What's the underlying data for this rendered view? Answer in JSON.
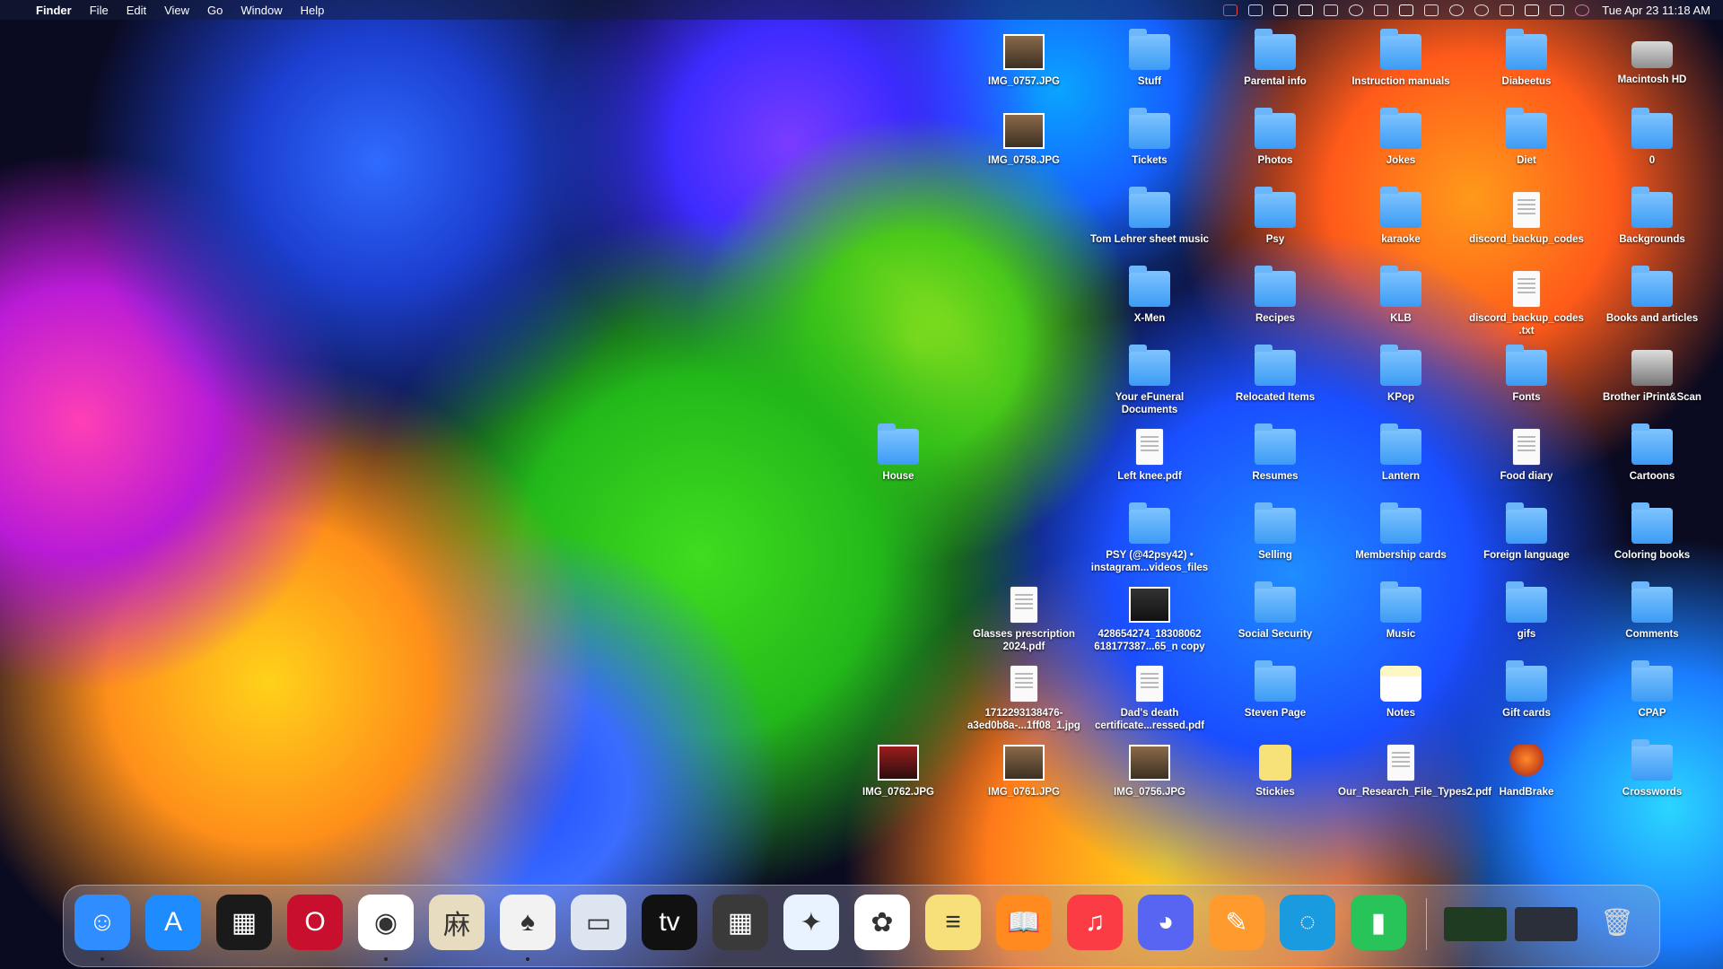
{
  "menubar": {
    "apple": "",
    "app_name": "Finder",
    "menus": [
      "File",
      "Edit",
      "View",
      "Go",
      "Window",
      "Help"
    ],
    "clock": "Tue Apr 23  11:18 AM",
    "status_icons": [
      "dropbox-icon",
      "audio-icon",
      "cloud-icon",
      "mail-icon",
      "display-icon",
      "play-icon",
      "bluetooth-icon",
      "wifi-icon",
      "keyboard-icon",
      "user-icon",
      "time-machine-icon",
      "eject-icon",
      "search-icon",
      "control-center-icon",
      "siri-icon"
    ]
  },
  "desktop": {
    "icons": [
      {
        "label": "IMG_0757.JPG",
        "type": "photo",
        "col": 0,
        "row": 0
      },
      {
        "label": "IMG_0758.JPG",
        "type": "photo",
        "col": 0,
        "row": 1
      },
      {
        "label": "Stuff",
        "type": "folder",
        "col": 1,
        "row": 0
      },
      {
        "label": "Tickets",
        "type": "folder",
        "col": 1,
        "row": 1
      },
      {
        "label": "Tom Lehrer sheet music",
        "type": "folder",
        "col": 1,
        "row": 2
      },
      {
        "label": "X-Men",
        "type": "folder",
        "col": 1,
        "row": 3
      },
      {
        "label": "Your eFuneral Documents",
        "type": "folder",
        "col": 1,
        "row": 4
      },
      {
        "label": "Parental info",
        "type": "folder",
        "col": 2,
        "row": 0
      },
      {
        "label": "Photos",
        "type": "folder",
        "col": 2,
        "row": 1
      },
      {
        "label": "Psy",
        "type": "folder",
        "col": 2,
        "row": 2
      },
      {
        "label": "Recipes",
        "type": "folder",
        "col": 2,
        "row": 3
      },
      {
        "label": "Relocated Items",
        "type": "folder",
        "col": 2,
        "row": 4
      },
      {
        "label": "Instruction manuals",
        "type": "folder",
        "col": 3,
        "row": 0
      },
      {
        "label": "Jokes",
        "type": "folder",
        "col": 3,
        "row": 1
      },
      {
        "label": "karaoke",
        "type": "folder",
        "col": 3,
        "row": 2
      },
      {
        "label": "KLB",
        "type": "folder",
        "col": 3,
        "row": 3
      },
      {
        "label": "KPop",
        "type": "folder",
        "col": 3,
        "row": 4
      },
      {
        "label": "Diabeetus",
        "type": "folder",
        "col": 4,
        "row": 0
      },
      {
        "label": "Diet",
        "type": "folder",
        "col": 4,
        "row": 1
      },
      {
        "label": "discord_backup_codes",
        "type": "doc",
        "col": 4,
        "row": 2
      },
      {
        "label": "discord_backup_codes .txt",
        "type": "doc",
        "col": 4,
        "row": 3
      },
      {
        "label": "Fonts",
        "type": "folder",
        "col": 4,
        "row": 4
      },
      {
        "label": "Macintosh HD",
        "type": "disk",
        "col": 5,
        "row": 0
      },
      {
        "label": "0",
        "type": "folder",
        "col": 5,
        "row": 1
      },
      {
        "label": "Backgrounds",
        "type": "folder",
        "col": 5,
        "row": 2
      },
      {
        "label": "Books and articles",
        "type": "folder",
        "col": 5,
        "row": 3
      },
      {
        "label": "Brother iPrint&Scan",
        "type": "printer",
        "col": 5,
        "row": 4
      },
      {
        "label": "House",
        "type": "folder",
        "col": -1,
        "row": 5
      },
      {
        "label": "Left knee.pdf",
        "type": "doc",
        "col": 1,
        "row": 5
      },
      {
        "label": "Resumes",
        "type": "folder",
        "col": 2,
        "row": 5
      },
      {
        "label": "Lantern",
        "type": "folder",
        "col": 3,
        "row": 5
      },
      {
        "label": "Food diary",
        "type": "doc",
        "col": 4,
        "row": 5
      },
      {
        "label": "Cartoons",
        "type": "folder",
        "col": 5,
        "row": 5
      },
      {
        "label": "PSY (@42psy42) • instagram...videos_files",
        "type": "folder",
        "col": 1,
        "row": 6
      },
      {
        "label": "Selling",
        "type": "folder",
        "col": 2,
        "row": 6
      },
      {
        "label": "Membership cards",
        "type": "folder",
        "col": 3,
        "row": 6
      },
      {
        "label": "Foreign language",
        "type": "folder",
        "col": 4,
        "row": 6
      },
      {
        "label": "Coloring books",
        "type": "folder",
        "col": 5,
        "row": 6
      },
      {
        "label": "Glasses prescription 2024.pdf",
        "type": "doc",
        "col": 0,
        "row": 7
      },
      {
        "label": "428654274_18308062 618177387...65_n copy",
        "type": "photo-dark",
        "col": 1,
        "row": 7
      },
      {
        "label": "Social Security",
        "type": "folder",
        "col": 2,
        "row": 7
      },
      {
        "label": "Music",
        "type": "folder",
        "col": 3,
        "row": 7
      },
      {
        "label": "gifs",
        "type": "folder",
        "col": 4,
        "row": 7
      },
      {
        "label": "Comments",
        "type": "folder",
        "col": 5,
        "row": 7
      },
      {
        "label": "1712293138476-a3ed0b8a-...1ff08_1.jpg",
        "type": "doc",
        "col": 0,
        "row": 8
      },
      {
        "label": "Dad's death certificate...ressed.pdf",
        "type": "doc",
        "col": 1,
        "row": 8
      },
      {
        "label": "Steven Page",
        "type": "folder",
        "col": 2,
        "row": 8
      },
      {
        "label": "Notes",
        "type": "note",
        "col": 3,
        "row": 8
      },
      {
        "label": "Gift cards",
        "type": "folder",
        "col": 4,
        "row": 8
      },
      {
        "label": "CPAP",
        "type": "folder",
        "col": 5,
        "row": 8
      },
      {
        "label": "IMG_0762.JPG",
        "type": "photo-red",
        "col": -1,
        "row": 9
      },
      {
        "label": "IMG_0761.JPG",
        "type": "photo",
        "col": 0,
        "row": 9
      },
      {
        "label": "IMG_0756.JPG",
        "type": "photo",
        "col": 1,
        "row": 9
      },
      {
        "label": "Stickies",
        "type": "sticky",
        "col": 2,
        "row": 9
      },
      {
        "label": "Our_Research_File_Types2.pdf",
        "type": "doc",
        "col": 3,
        "row": 9
      },
      {
        "label": "HandBrake",
        "type": "handbrake",
        "col": 4,
        "row": 9
      },
      {
        "label": "Crosswords",
        "type": "folder",
        "col": 5,
        "row": 9
      }
    ]
  },
  "dock": {
    "apps": [
      {
        "name": "finder-icon",
        "glyph": "☺",
        "color": "#2f8dff",
        "running": true
      },
      {
        "name": "app-store-icon",
        "glyph": "A",
        "color": "#1e8bff",
        "running": false
      },
      {
        "name": "mission-control-icon",
        "glyph": "▦",
        "color": "#1a1a1a",
        "running": false
      },
      {
        "name": "opera-icon",
        "glyph": "O",
        "color": "#c8102e",
        "running": false
      },
      {
        "name": "chrome-icon",
        "glyph": "◉",
        "color": "#ffffff",
        "running": true
      },
      {
        "name": "mahjong-icon",
        "glyph": "麻",
        "color": "#e8dcc0",
        "running": false
      },
      {
        "name": "solitaire-icon",
        "glyph": "♠",
        "color": "#f2f2f2",
        "running": true
      },
      {
        "name": "preview-icon",
        "glyph": "▭",
        "color": "#dde6f0",
        "running": false
      },
      {
        "name": "apple-tv-icon",
        "glyph": "tv",
        "color": "#111111",
        "running": false
      },
      {
        "name": "calculator-icon",
        "glyph": "▦",
        "color": "#3a3a3a",
        "running": false
      },
      {
        "name": "safari-icon",
        "glyph": "✦",
        "color": "#e9f3ff",
        "running": false
      },
      {
        "name": "photos-icon",
        "glyph": "✿",
        "color": "#ffffff",
        "running": false
      },
      {
        "name": "notes-icon",
        "glyph": "≡",
        "color": "#f7e07a",
        "running": false
      },
      {
        "name": "books-icon",
        "glyph": "📖",
        "color": "#ff8a1f",
        "running": false
      },
      {
        "name": "music-icon",
        "glyph": "♫",
        "color": "#fc3c44",
        "running": false
      },
      {
        "name": "discord-icon",
        "glyph": "◕",
        "color": "#5865f2",
        "running": false
      },
      {
        "name": "pages-icon",
        "glyph": "✎",
        "color": "#ff9a2e",
        "running": false
      },
      {
        "name": "edge-icon",
        "glyph": "◌",
        "color": "#1a9be0",
        "running": false
      },
      {
        "name": "numbers-icon",
        "glyph": "▮",
        "color": "#28c45a",
        "running": false
      }
    ],
    "recents": [
      {
        "name": "recent-window-1-icon",
        "color": "#1f3b22"
      },
      {
        "name": "recent-window-2-icon",
        "color": "#2a2f3a"
      }
    ],
    "trash": {
      "name": "trash-icon",
      "glyph": "🗑",
      "color": "#d8d8d8"
    }
  }
}
